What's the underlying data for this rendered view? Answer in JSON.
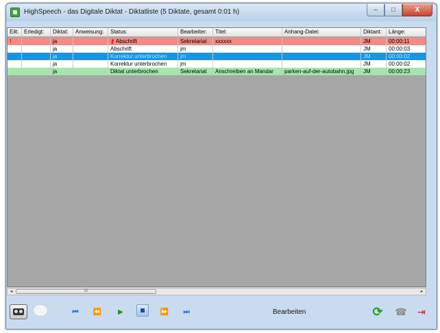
{
  "window": {
    "title": "HighSpeech - das Digitale Diktat - Diktatliste (5 Diktate, gesamt 0:01 h)",
    "buttons": {
      "minimize": "–",
      "maximize": "□",
      "close": "X"
    }
  },
  "table": {
    "columns": [
      "Eilt:",
      "Erledigt:",
      "Diktat:",
      "Anweisung:",
      "Status:",
      "Bearbeiter:",
      "Titel:",
      "Anhang-Datei:",
      "Diktant:",
      "Länge:"
    ],
    "rows": [
      {
        "eilt": "!",
        "erledigt": "",
        "diktat": "ja",
        "anweisung": "",
        "status": "Abschrift",
        "bearbeiter": "Sekretariat",
        "titel": "xxxxxx",
        "anhang": "",
        "diktant": "JM",
        "laenge": "00:00:11",
        "highlight": "red"
      },
      {
        "eilt": "",
        "erledigt": "",
        "diktat": "ja",
        "anweisung": "",
        "status": "Abschrift",
        "bearbeiter": "jm",
        "titel": "",
        "anhang": "",
        "diktant": "JM",
        "laenge": "00:00:03",
        "highlight": "white"
      },
      {
        "eilt": "",
        "erledigt": "",
        "diktat": "ja",
        "anweisung": "",
        "status": "Korrektur unterbrochen",
        "bearbeiter": "jm",
        "titel": "",
        "anhang": "",
        "diktant": "JM",
        "laenge": "00:00:02",
        "highlight": "blue"
      },
      {
        "eilt": "",
        "erledigt": "",
        "diktat": "ja",
        "anweisung": "",
        "status": "Korrektur unterbrochen",
        "bearbeiter": "jm",
        "titel": "",
        "anhang": "",
        "diktant": "JM",
        "laenge": "00:00:02",
        "highlight": "white"
      },
      {
        "eilt": "",
        "erledigt": "",
        "diktat": "ja",
        "anweisung": "",
        "status": "Diktat unterbrochen",
        "bearbeiter": "Sekretariat",
        "titel": "Anschreiben an Mandar",
        "anhang": "parken-auf-der-autobahn.jpg",
        "diktant": "JM",
        "laenge": "00:00:23",
        "highlight": "green"
      }
    ]
  },
  "scrollbar": {
    "left": "◂",
    "right": "▸",
    "grip": "III"
  },
  "toolbar": {
    "label": "Bearbeiten",
    "icons": {
      "tape": "cassette-icon",
      "comment": "speech-bubble-icon",
      "skip_start": "⏮",
      "rewind": "⏪",
      "play": "▶",
      "stop": "■",
      "forward": "⏩",
      "skip_end": "⏭",
      "refresh": "⟳",
      "phone": "☎",
      "exit": "⇥"
    }
  },
  "colors": {
    "row_red": "#f08b86",
    "row_blue": "#1496e6",
    "row_green": "#a7e4b1",
    "grid_bg": "#a6a6a6"
  }
}
